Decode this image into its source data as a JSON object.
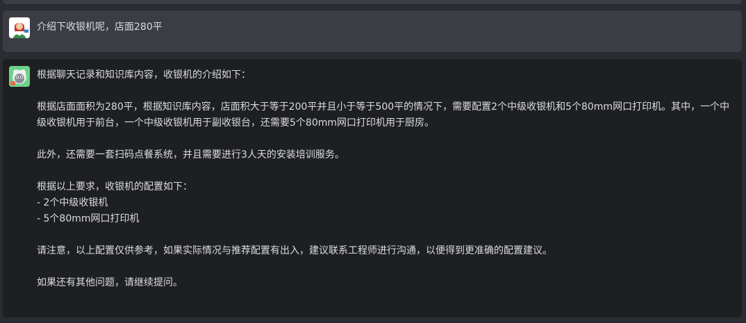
{
  "conversation": {
    "user_message": {
      "avatar_icon": "user-avatar-icon",
      "text": "介绍下收银机呢，店面280平"
    },
    "assistant_message": {
      "avatar_icon": "bot-avatar-icon",
      "paragraphs": [
        "根据聊天记录和知识库内容，收银机的介绍如下：",
        "根据店面面积为280平，根据知识库内容，店面积大于等于200平并且小于等于500平的情况下，需要配置2个中级收银机和5个80mm网口打印机。其中，一个中级收银机用于前台，一个中级收银机用于副收银台，还需要5个80mm网口打印机用于厨房。",
        "此外，还需要一套扫码点餐系统，并且需要进行3人天的安装培训服务。",
        "根据以上要求，收银机的配置如下：",
        "- 2个中级收银机",
        "- 5个80mm网口打印机",
        "请注意，以上配置仅供参考，如果实际情况与推荐配置有出入，建议联系工程师进行沟通，以便得到更准确的配置建议。",
        "如果还有其他问题，请继续提问。"
      ]
    }
  },
  "colors": {
    "page_bg": "#2b2c31",
    "user_bubble_bg": "#3b3c44",
    "assistant_bubble_bg": "#1e1f21",
    "text": "#dcdde2"
  }
}
